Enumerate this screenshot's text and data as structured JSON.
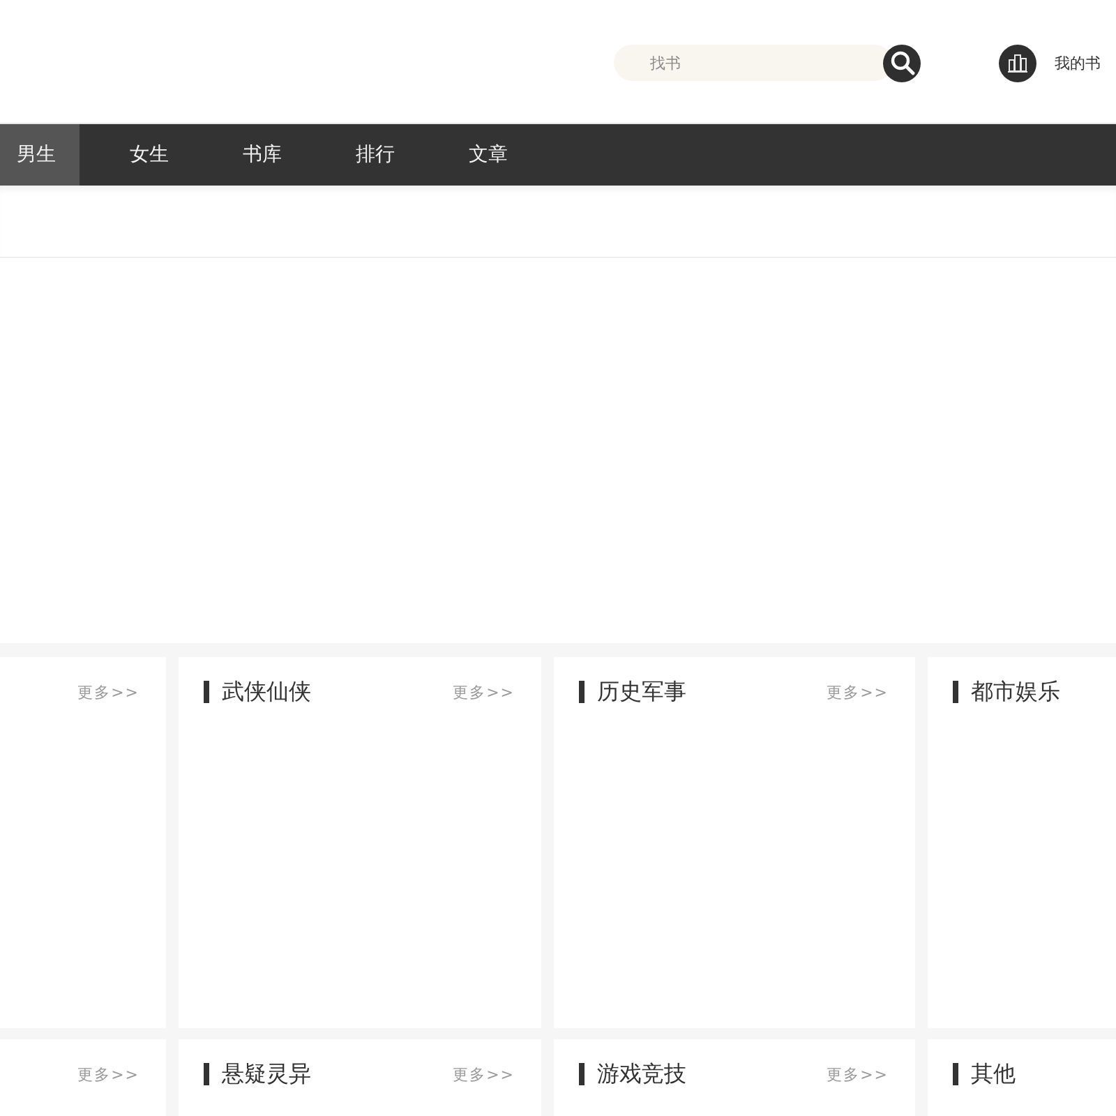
{
  "header": {
    "search": {
      "placeholder": "找书"
    },
    "bookshelf_link": {
      "label": "我的书"
    }
  },
  "nav": {
    "items": [
      {
        "label": "男生",
        "selected": true
      },
      {
        "label": "女生",
        "selected": false
      },
      {
        "label": "书库",
        "selected": false
      },
      {
        "label": "排行",
        "selected": false
      },
      {
        "label": "文章",
        "selected": false
      }
    ]
  },
  "category_cards": [
    {
      "more": "更多>>"
    },
    {
      "title": "武侠仙侠",
      "more": "更多>>"
    },
    {
      "title": "历史军事",
      "more": "更多>>"
    },
    {
      "title": "都市娱乐"
    },
    {
      "more": "更多>>"
    },
    {
      "title": "悬疑灵异",
      "more": "更多>>"
    },
    {
      "title": "游戏竞技",
      "more": "更多>>"
    },
    {
      "title": "其他"
    }
  ]
}
